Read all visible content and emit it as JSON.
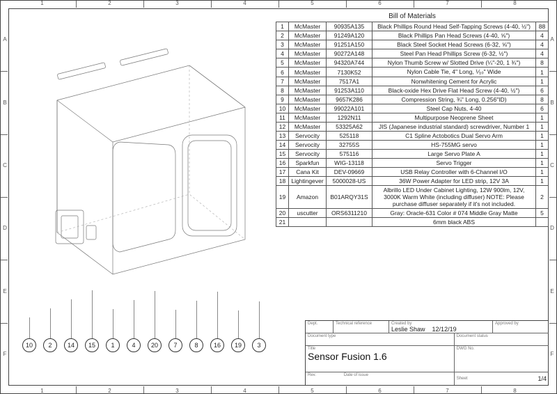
{
  "ruler": {
    "cols": [
      "1",
      "2",
      "3",
      "4",
      "5",
      "6",
      "7",
      "8"
    ],
    "rows": [
      "A",
      "B",
      "C",
      "D",
      "E",
      "F"
    ]
  },
  "bom": {
    "title": "Bill of Materials",
    "rows": [
      {
        "n": "1",
        "v": "McMaster",
        "p": "90935A135",
        "d": "Black Phillips Round Head Self-Tapping Screws (4-40, ½\")",
        "q": "88"
      },
      {
        "n": "2",
        "v": "McMaster",
        "p": "91249A120",
        "d": "Black Phillips Pan Head Screws (4-40, ⅝\")",
        "q": "4"
      },
      {
        "n": "3",
        "v": "McMaster",
        "p": "91251A150",
        "d": "Black Steel Socket Head Screws (6-32, ⅝\")",
        "q": "4"
      },
      {
        "n": "4",
        "v": "McMaster",
        "p": "90272A148",
        "d": "Steel Pan Head Phillips Screw (6-32, ½\")",
        "q": "4"
      },
      {
        "n": "5",
        "v": "McMaster",
        "p": "94320A744",
        "d": "Nylon Thumb Screw w/ Slotted Drive (¼\"-20, 1 ¾\")",
        "q": "8"
      },
      {
        "n": "6",
        "v": "McMaster",
        "p": "7130K52",
        "d": "Nylon Cable Tie, 4\" Long, ⅒\" Wide",
        "q": "1"
      },
      {
        "n": "7",
        "v": "McMaster",
        "p": "7517A1",
        "d": "Nonwhitening Cement for Acrylic",
        "q": "1"
      },
      {
        "n": "8",
        "v": "McMaster",
        "p": "91253A110",
        "d": "Black-oxide Hex Drive Flat Head Screw (4-40, ½\")",
        "q": "6"
      },
      {
        "n": "9",
        "v": "McMaster",
        "p": "9657K286",
        "d": "Compression String, ¾\" Long, 0.256\"ID)",
        "q": "8"
      },
      {
        "n": "10",
        "v": "McMaster",
        "p": "99022A101",
        "d": "Steel Cap Nuts, 4-40",
        "q": "6"
      },
      {
        "n": "11",
        "v": "McMaster",
        "p": "1292N11",
        "d": "Multipurpose Neoprene Sheet",
        "q": "1"
      },
      {
        "n": "12",
        "v": "McMaster",
        "p": "53325A62",
        "d": "JIS (Japanese industrial standard) screwdriver, Number 1",
        "q": "1"
      },
      {
        "n": "13",
        "v": "Servocity",
        "p": "525118",
        "d": "C1 Spline Actobotics Dual Servo Arm",
        "q": "1"
      },
      {
        "n": "14",
        "v": "Servocity",
        "p": "32755S",
        "d": "HS-755MG servo",
        "q": "1"
      },
      {
        "n": "15",
        "v": "Servocity",
        "p": "575116",
        "d": "Large Servo Plate A",
        "q": "1"
      },
      {
        "n": "16",
        "v": "Sparkfun",
        "p": "WIG-13118",
        "d": "Servo Trigger",
        "q": "1"
      },
      {
        "n": "17",
        "v": "Cana Kit",
        "p": "DEV-09669",
        "d": "USB Relay Controller with 6-Channel I/O",
        "q": "1"
      },
      {
        "n": "18",
        "v": "Lightingever",
        "p": "5000028-US",
        "d": "36W Power Adapter for LED strip, 12V 3A",
        "q": "1"
      },
      {
        "n": "19",
        "v": "Amazon",
        "p": "B01ARQY31S",
        "d": "Albrillo LED Under Cabinet Lighting, 12W 900lm, 12V, 3000K Warm White (including diffuser) NOTE: Please purchase diffuser separately if it's not included.",
        "q": "2"
      },
      {
        "n": "20",
        "v": "uscutter",
        "p": "ORS6311210",
        "d": "Gray: Oracle-631 Color # 074 Middle Gray Matte",
        "q": "5"
      },
      {
        "n": "21",
        "v": "",
        "p": "",
        "d": "6mm black ABS",
        "q": ""
      }
    ]
  },
  "balloons": [
    "10",
    "2",
    "14",
    "15",
    "1",
    "4",
    "20",
    "7",
    "8",
    "16",
    "19",
    "3"
  ],
  "titleblock": {
    "labels": {
      "dept": "Dept.",
      "techref": "Technical reference",
      "created": "Created by",
      "approved": "Approved by",
      "doctype": "Document type",
      "docstatus": "Document status",
      "title": "Title",
      "dwg": "DWG No.",
      "rev": "Rev.",
      "date": "Date of issue",
      "sheet": "Sheet"
    },
    "created_by": "Leslie Shaw",
    "created_date": "12/12/19",
    "title": "Sensor Fusion 1.6",
    "sheet": "1/4"
  }
}
